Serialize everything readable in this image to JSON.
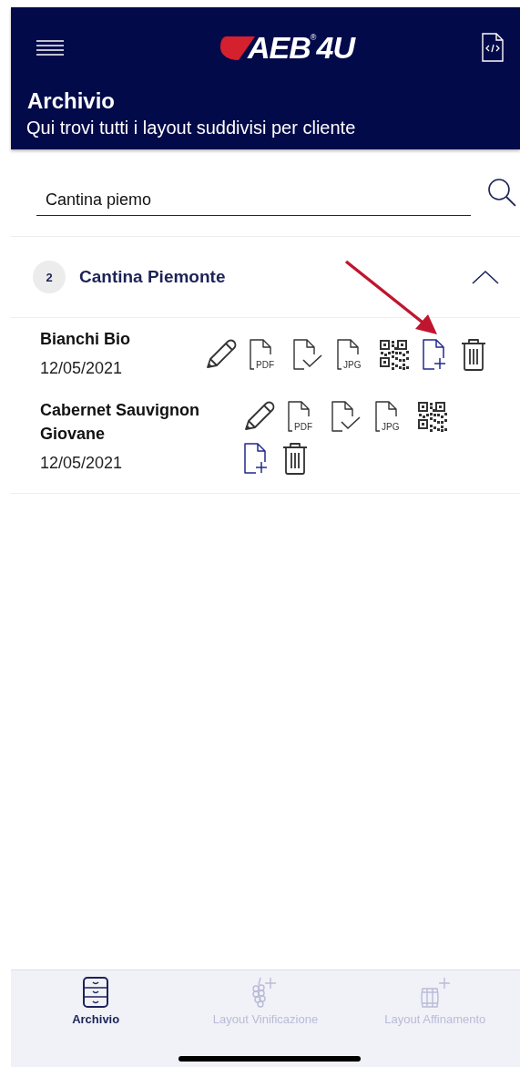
{
  "header": {
    "logo": {
      "name": "AEB",
      "mark": "®",
      "suffix": "4U"
    },
    "title": "Archivio",
    "subtitle": "Qui trovi tutti i layout suddivisi per cliente"
  },
  "search": {
    "value": "Cantina piemo"
  },
  "groups": [
    {
      "count": "2",
      "name": "Cantina Piemonte",
      "expanded": true,
      "items": [
        {
          "name": "Bianchi Bio",
          "date": "12/05/2021",
          "actions": [
            {
              "kind": "edit"
            },
            {
              "kind": "file",
              "label": "PDF"
            },
            {
              "kind": "approve"
            },
            {
              "kind": "file",
              "label": "JPG"
            },
            {
              "kind": "qr"
            },
            {
              "kind": "add"
            },
            {
              "kind": "delete"
            }
          ]
        },
        {
          "name": "Cabernet Sauvignon Giovane",
          "date": "12/05/2021",
          "actions": [
            {
              "kind": "edit"
            },
            {
              "kind": "file",
              "label": "PDF"
            },
            {
              "kind": "approve"
            },
            {
              "kind": "file",
              "label": "JPG"
            },
            {
              "kind": "qr"
            },
            {
              "kind": "add"
            },
            {
              "kind": "delete"
            }
          ]
        }
      ]
    }
  ],
  "tabs": [
    {
      "kind": "cabinet",
      "label": "Archivio",
      "selected": true
    },
    {
      "kind": "grapes",
      "label": "Layout Vinificazione",
      "selected": false
    },
    {
      "kind": "barrel",
      "label": "Layout Affinamento",
      "selected": false
    }
  ]
}
